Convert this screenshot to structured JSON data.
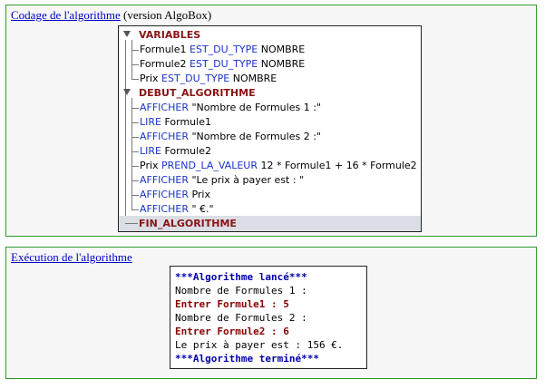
{
  "code_panel": {
    "title_link": "Codage de l'algorithme",
    "title_suffix": " (version AlgoBox)"
  },
  "tree": {
    "variables_header": "VARIABLES",
    "variables": [
      {
        "name": "Formule1",
        "kw": "EST_DU_TYPE",
        "type": "NOMBRE"
      },
      {
        "name": "Formule2",
        "kw": "EST_DU_TYPE",
        "type": "NOMBRE"
      },
      {
        "name": "Prix",
        "kw": "EST_DU_TYPE",
        "type": "NOMBRE"
      }
    ],
    "debut_header": "DEBUT_ALGORITHME",
    "instructions": [
      {
        "kw": "AFFICHER",
        "rest": "\"Nombre de Formules 1 :\""
      },
      {
        "kw": "LIRE",
        "rest": "Formule1"
      },
      {
        "kw": "AFFICHER",
        "rest": "\"Nombre de Formules 2 :\""
      },
      {
        "kw": "LIRE",
        "rest": "Formule2"
      },
      {
        "pre": "Prix",
        "kw": "PREND_LA_VALEUR",
        "rest": "12 * Formule1 + 16 * Formule2"
      },
      {
        "kw": "AFFICHER",
        "rest": "\"Le prix à payer est : \""
      },
      {
        "kw": "AFFICHER",
        "rest": "Prix"
      },
      {
        "kw": "AFFICHER",
        "rest": "\" €.\""
      }
    ],
    "fin_header": "FIN_ALGORITHME"
  },
  "exec_panel": {
    "title_link": "Exécution de l'algorithme"
  },
  "console": {
    "lines": [
      {
        "text": "***Algorithme lancé***",
        "style": "blue"
      },
      {
        "text": "Nombre de Formules 1 :",
        "style": "black"
      },
      {
        "text": "Entrer Formule1 : 5",
        "style": "red"
      },
      {
        "text": "Nombre de Formules 2 :",
        "style": "black"
      },
      {
        "text": "Entrer Formule2 : 6",
        "style": "red"
      },
      {
        "text": "Le prix à payer est : 156 €.",
        "style": "black"
      },
      {
        "text": "***Algorithme terminé***",
        "style": "blue"
      }
    ]
  },
  "colors": {
    "panel_border": "#2e9c2e",
    "link": "#0000cc",
    "keyword_section": "#8a1414",
    "keyword_instruction": "#1a35c8",
    "console_status": "#0000aa",
    "console_input": "#8a0000"
  }
}
